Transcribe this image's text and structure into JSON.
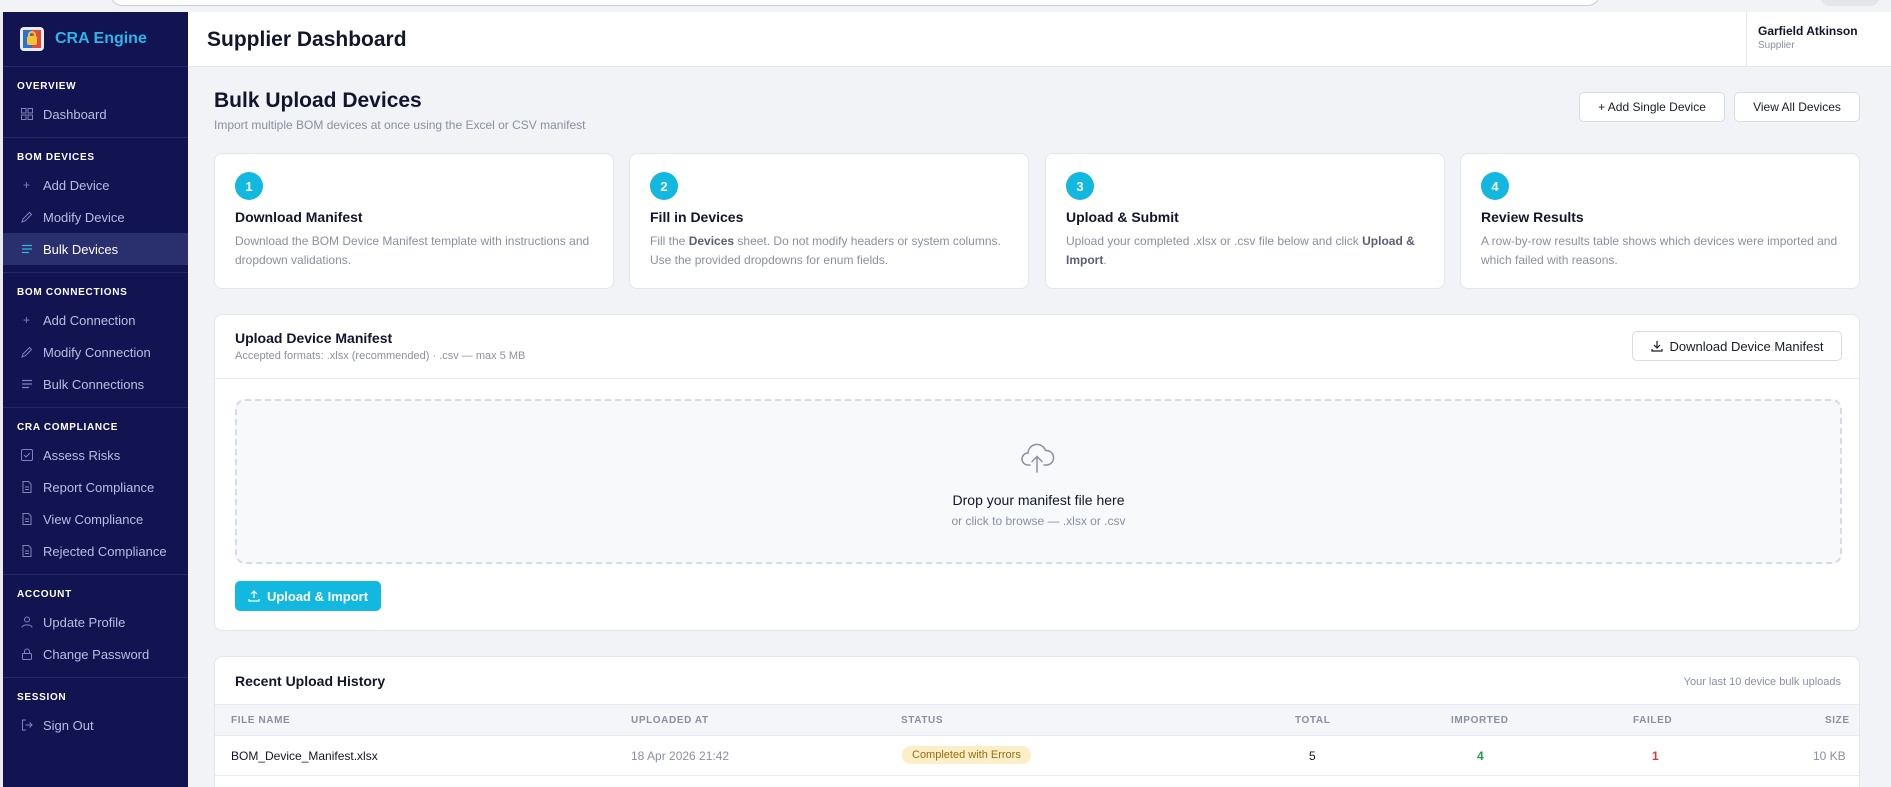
{
  "brand": {
    "name": "CRA Engine"
  },
  "header": {
    "title": "Supplier Dashboard",
    "user_name": "Garfield Atkinson",
    "user_role": "Supplier"
  },
  "sidebar": {
    "sections": [
      {
        "heading": "OVERVIEW",
        "items": [
          {
            "label": "Dashboard",
            "icon": "grid-icon"
          }
        ]
      },
      {
        "heading": "BOM DEVICES",
        "items": [
          {
            "label": "Add Device",
            "icon": "plus-icon"
          },
          {
            "label": "Modify Device",
            "icon": "pencil-icon"
          },
          {
            "label": "Bulk Devices",
            "icon": "list-icon",
            "active": true
          }
        ]
      },
      {
        "heading": "BOM CONNECTIONS",
        "items": [
          {
            "label": "Add Connection",
            "icon": "plus-icon"
          },
          {
            "label": "Modify Connection",
            "icon": "pencil-icon"
          },
          {
            "label": "Bulk Connections",
            "icon": "list-icon"
          }
        ]
      },
      {
        "heading": "CRA COMPLIANCE",
        "items": [
          {
            "label": "Assess Risks",
            "icon": "checkbox-icon"
          },
          {
            "label": "Report Compliance",
            "icon": "document-icon"
          },
          {
            "label": "View Compliance",
            "icon": "document-icon"
          },
          {
            "label": "Rejected Compliance",
            "icon": "document-icon"
          }
        ]
      },
      {
        "heading": "ACCOUNT",
        "items": [
          {
            "label": "Update Profile",
            "icon": "user-icon"
          },
          {
            "label": "Change Password",
            "icon": "lock-icon"
          }
        ]
      },
      {
        "heading": "SESSION",
        "items": [
          {
            "label": "Sign Out",
            "icon": "sign-out-icon"
          }
        ]
      }
    ]
  },
  "page": {
    "title": "Bulk Upload Devices",
    "subtitle": "Import multiple BOM devices at once using the Excel or CSV manifest",
    "add_single_label": "+ Add Single Device",
    "view_all_label": "View All Devices"
  },
  "steps": [
    {
      "num": "1",
      "title": "Download Manifest",
      "desc": "Download the BOM Device Manifest template with instructions and dropdown validations."
    },
    {
      "num": "2",
      "title": "Fill in Devices",
      "desc_pre": "Fill the ",
      "desc_bold": "Devices",
      "desc_post": " sheet. Do not modify headers or system columns. Use the provided dropdowns for enum fields."
    },
    {
      "num": "3",
      "title": "Upload & Submit",
      "desc_pre": "Upload your completed .xlsx or .csv file below and click ",
      "desc_bold": "Upload & Import",
      "desc_post": "."
    },
    {
      "num": "4",
      "title": "Review Results",
      "desc": "A row-by-row results table shows which devices were imported and which failed with reasons."
    }
  ],
  "upload": {
    "title": "Upload Device Manifest",
    "formats": "Accepted formats: .xlsx (recommended) · .csv — max 5 MB",
    "download_label": "Download Device Manifest",
    "drop_title": "Drop your manifest file here",
    "drop_sub": "or click to browse — .xlsx or .csv",
    "upload_label": "Upload & Import"
  },
  "history": {
    "title": "Recent Upload History",
    "subtitle": "Your last 10 device bulk uploads",
    "columns": [
      "FILE NAME",
      "UPLOADED AT",
      "STATUS",
      "TOTAL",
      "IMPORTED",
      "FAILED",
      "SIZE"
    ],
    "rows": [
      {
        "file": "BOM_Device_Manifest.xlsx",
        "uploaded": "18 Apr 2026 21:42",
        "status": "Completed with Errors",
        "total": "5",
        "imported": "4",
        "failed": "1",
        "size": "10 KB"
      }
    ]
  },
  "colors": {
    "sidebar_bg": "#121452",
    "accent": "#12b8e0",
    "brand_text": "#29b6e8",
    "status_warning_bg": "#fcefc8"
  }
}
